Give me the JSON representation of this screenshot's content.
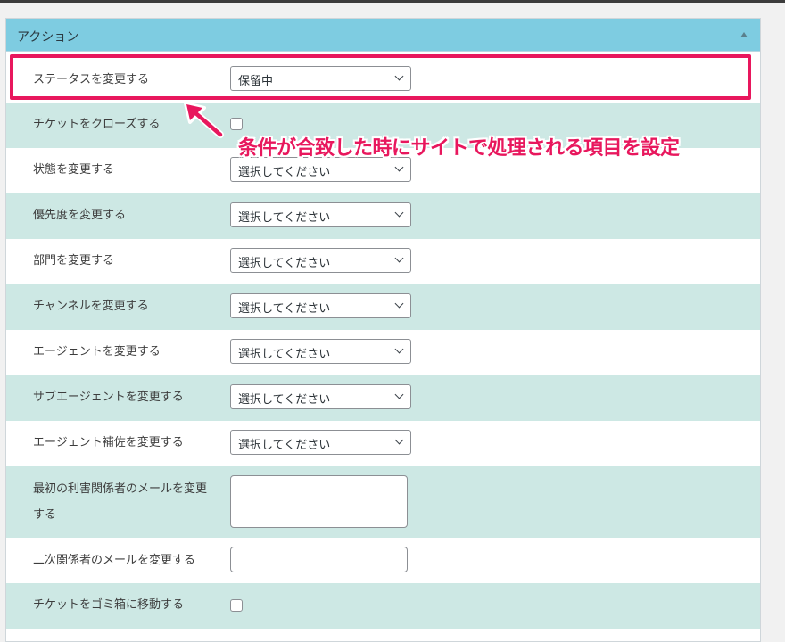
{
  "panel": {
    "title": "アクション",
    "rows": [
      {
        "label": "ステータスを変更する",
        "value": "保留中"
      },
      {
        "label": "チケットをクローズする"
      },
      {
        "label": "状態を変更する",
        "value": "選択してください"
      },
      {
        "label": "優先度を変更する",
        "value": "選択してください"
      },
      {
        "label": "部門を変更する",
        "value": "選択してください"
      },
      {
        "label": "チャンネルを変更する",
        "value": "選択してください"
      },
      {
        "label": "エージェントを変更する",
        "value": "選択してください"
      },
      {
        "label": "サブエージェントを変更する",
        "value": "選択してください"
      },
      {
        "label": "エージェント補佐を変更する",
        "value": "選択してください"
      },
      {
        "label": "最初の利害関係者のメールを変更",
        "label2": "する"
      },
      {
        "label": "二次関係者のメールを変更する"
      },
      {
        "label": "チケットをゴミ箱に移動する"
      }
    ]
  },
  "annotation": {
    "text": "条件が合致した時にサイトで処理される項目を設定",
    "color": "#e8175d"
  }
}
